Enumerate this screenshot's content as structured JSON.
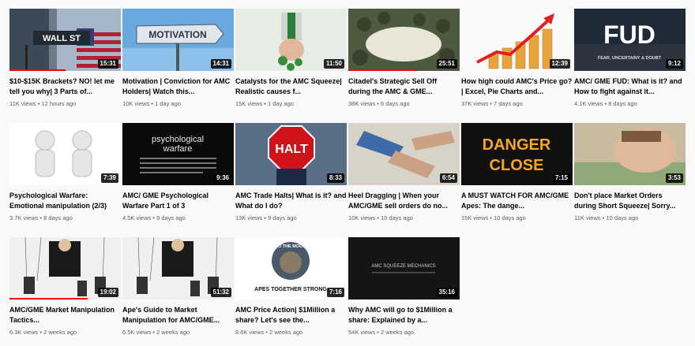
{
  "videos": [
    {
      "title": "$10-$15K Brackets? NO! let me tell you why| 3 Parts of...",
      "views": "11K views",
      "age": "12 hours ago",
      "duration": "15:31",
      "progress": 0.5,
      "thumb_text": "WALL ST"
    },
    {
      "title": "Motivation | Conviction for AMC Holders| Watch this...",
      "views": "10K views",
      "age": "1 day ago",
      "duration": "14:31",
      "progress": 0,
      "thumb_text": "MOTIVATION"
    },
    {
      "title": "Catalysts for the AMC Squeeze| Realistic causes f...",
      "views": "15K views",
      "age": "1 day ago",
      "duration": "11:50",
      "progress": 0,
      "thumb_text": ""
    },
    {
      "title": "Citadel's Strategic Sell Off during the AMC & GME...",
      "views": "38K views",
      "age": "6 days ago",
      "duration": "25:51",
      "progress": 0.6,
      "thumb_text": ""
    },
    {
      "title": "How high could AMC's Price go? | Excel, Pie Charts and...",
      "views": "37K views",
      "age": "7 days ago",
      "duration": "12:39",
      "progress": 0,
      "thumb_text": ""
    },
    {
      "title": "AMC/ GME FUD: What is it? and How to fight against it...",
      "views": "4.1K views",
      "age": "8 days ago",
      "duration": "9:12",
      "progress": 0,
      "thumb_text": "FUD",
      "thumb_sub": "FEAR, UNCERTAINY & DOUBT"
    },
    {
      "title": "Psychological Warfare: Emotional manipulation (2/3)",
      "views": "3.7K views",
      "age": "8 days ago",
      "duration": "7:39",
      "progress": 0,
      "thumb_text": ""
    },
    {
      "title": "AMC/ GME Psychological Warfare Part 1 of 3",
      "views": "4.5K views",
      "age": "9 days ago",
      "duration": "9:36",
      "progress": 0,
      "thumb_text": "psychological warfare"
    },
    {
      "title": "AMC Trade Halts| What is it? and What do I do?",
      "views": "13K views",
      "age": "9 days ago",
      "duration": "8:33",
      "progress": 0,
      "thumb_text": "HALT"
    },
    {
      "title": "Heel Dragging | When your AMC/GME sell orders do no...",
      "views": "10K views",
      "age": "10 days ago",
      "duration": "6:54",
      "progress": 0,
      "thumb_text": ""
    },
    {
      "title": "A MUST WATCH FOR AMC/GME Apes: The dange...",
      "views": "15K views",
      "age": "10 days ago",
      "duration": "7:15",
      "progress": 0,
      "thumb_text": "DANGER",
      "thumb_sub": "CLOSE"
    },
    {
      "title": "Don't place Market Orders during Short Squeeze| Sorry...",
      "views": "11K views",
      "age": "10 days ago",
      "duration": "3:53",
      "progress": 0,
      "thumb_text": ""
    },
    {
      "title": "AMC/GME Market Manipulation Tactics...",
      "views": "6.3K views",
      "age": "2 weeks ago",
      "duration": "19:02",
      "progress": 0.7,
      "thumb_text": ""
    },
    {
      "title": "Ape's Guide to Market Manipulation for AMC/GME...",
      "views": "6.5K views",
      "age": "2 weeks ago",
      "duration": "51:32",
      "progress": 0,
      "thumb_text": ""
    },
    {
      "title": "AMC Price Action| $1Million a share? Let's see the...",
      "views": "8.6K views",
      "age": "2 weeks ago",
      "duration": "7:16",
      "progress": 0,
      "thumb_text": "TO THE MOON",
      "thumb_sub": "APES TOGETHER STRONG"
    },
    {
      "title": "Why AMC will go to $1Million a share: Explained by a...",
      "views": "54K views",
      "age": "2 weeks ago",
      "duration": "35:16",
      "progress": 0,
      "thumb_text": "AMC SQUEEZE MECHANICS"
    }
  ]
}
